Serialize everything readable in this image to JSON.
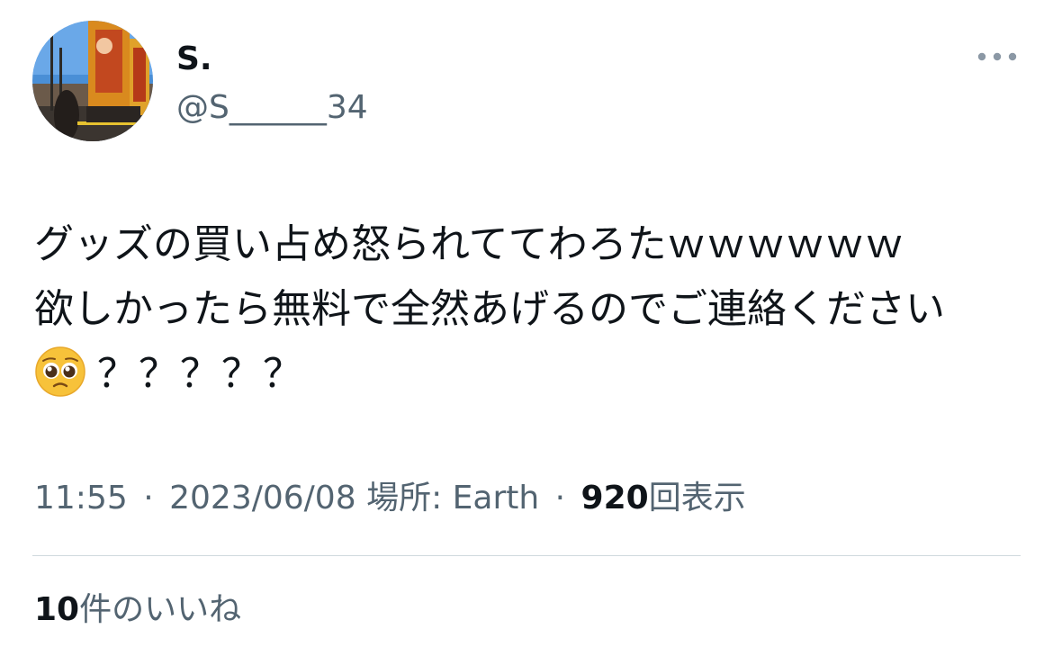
{
  "tweet": {
    "author": {
      "display_name": "S.",
      "handle": "@S______34"
    },
    "more_icon": "more-horizontal-icon",
    "text_lines": [
      "グッズの買い占め怒られててわろたｗｗｗｗｗｗ",
      "欲しかったら無料で全然あげるのでご連絡ください"
    ],
    "last_line": {
      "emoji": "pleading-face-emoji",
      "text": "？？？？？"
    },
    "meta": {
      "time": "11:55",
      "separator": "·",
      "date": "2023/06/08",
      "location_label": "場所: Earth",
      "views_count": "920",
      "views_label": "回表示"
    },
    "likes": {
      "count": "10",
      "label": "件のいいね"
    },
    "colors": {
      "text_primary": "#0f1419",
      "text_secondary": "#536471",
      "divider": "#cfd9de",
      "background": "#ffffff"
    }
  }
}
